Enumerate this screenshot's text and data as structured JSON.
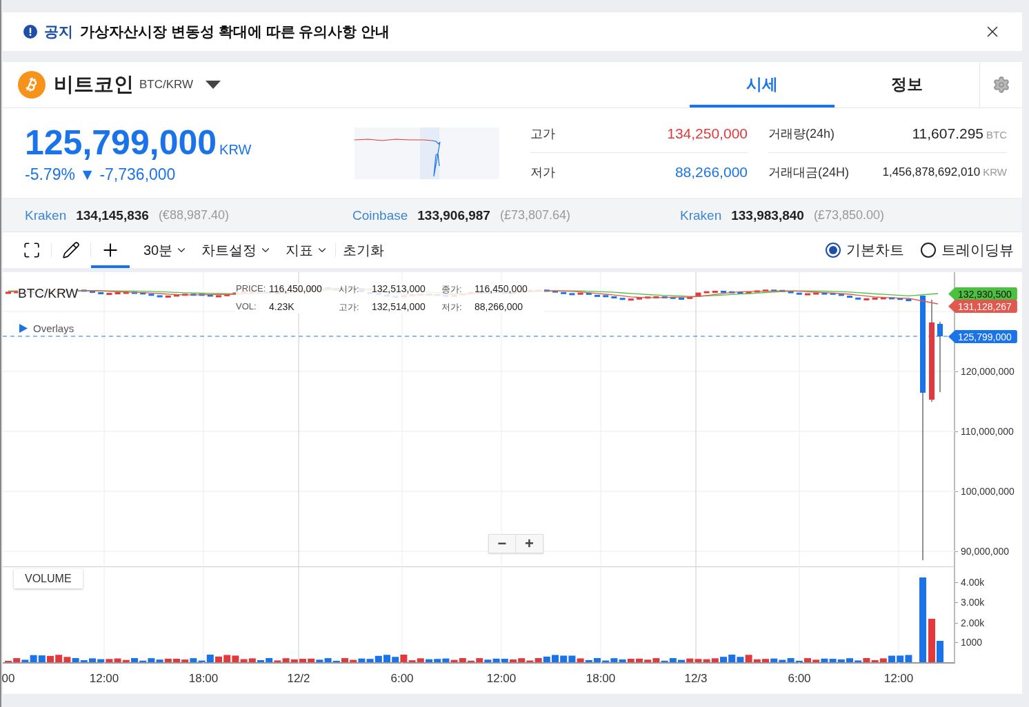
{
  "notice": {
    "badge": "공지",
    "text": "가상자산시장 변동성 확대에 따른 유의사항 안내"
  },
  "coin": {
    "name": "비트코인",
    "pair": "BTC/KRW"
  },
  "tabs": [
    {
      "label": "시세",
      "selected": true
    },
    {
      "label": "정보",
      "selected": false
    }
  ],
  "price": {
    "value": "125,799,000",
    "unit": "KRW",
    "change_rate": "-5.79%",
    "arrow": "▼",
    "change": "-7,736,000"
  },
  "stats": [
    {
      "label": "고가",
      "value": "134,250,000",
      "color": "#e03a3e"
    },
    {
      "label": "거래량(24h)",
      "value": "11,607.295",
      "unit": "BTC"
    },
    {
      "label": "저가",
      "value": "88,266,000",
      "color": "#1a73e8"
    },
    {
      "label": "거래대금(24H)",
      "value": "1,456,878,692,010",
      "unit": "KRW"
    }
  ],
  "exchanges": [
    {
      "name": "Kraken",
      "price": "134,145,836",
      "foreign": "(€88,987.40)"
    },
    {
      "name": "Coinbase",
      "price": "133,906,987",
      "foreign": "(£73,807.64)"
    },
    {
      "name": "Kraken",
      "price": "133,983,840",
      "foreign": "(£73,850.00)"
    }
  ],
  "toolbar": {
    "tools": [
      {
        "kind": "fullscreen",
        "selected": false
      },
      {
        "kind": "draw",
        "selected": false
      },
      {
        "kind": "crosshair",
        "selected": true
      }
    ],
    "dropdowns": [
      "30분",
      "차트설정",
      "지표"
    ],
    "reset": "초기화",
    "views": [
      {
        "label": "기본차트",
        "selected": true
      },
      {
        "label": "트레이딩뷰",
        "selected": false
      }
    ]
  },
  "chart": {
    "symbol": "BTC/KRW",
    "info": [
      {
        "label": "PRICE:",
        "value": "116,450,000"
      },
      {
        "label": "시가:",
        "value": "132,513,000"
      },
      {
        "label": "종가:",
        "value": "116,450,000"
      },
      {
        "label": "VOL:",
        "value": "4.23K"
      },
      {
        "label": "고가:",
        "value": "132,514,000"
      },
      {
        "label": "저가:",
        "value": "88,266,000"
      }
    ],
    "overlays": "Overlays",
    "price_tags": [
      {
        "value": "132,930,500",
        "color": "#4cc13f"
      },
      {
        "value": "131,128,267",
        "color": "#e0584f"
      },
      {
        "value": "125,799,000",
        "color": "#1a73e8"
      }
    ],
    "y_labels": [
      "120,000,000",
      "110,000,000",
      "100,000,000",
      "90,000,000"
    ],
    "zoom": [
      "−",
      "+"
    ],
    "volume": {
      "label": "VOLUME",
      "y_labels": [
        "4.00k",
        "3.00k",
        "2.00k",
        "1000"
      ]
    },
    "x_labels": [
      "00",
      "12:00",
      "18:00",
      "12/2",
      "6:00",
      "12:00",
      "18:00",
      "12/3",
      "6:00",
      "12:00"
    ]
  }
}
